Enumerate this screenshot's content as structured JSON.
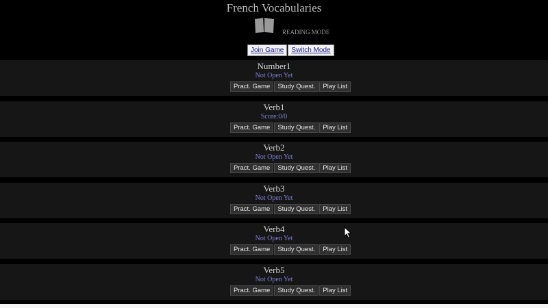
{
  "header": {
    "title": "French Vocabularies",
    "icon": "open-book-icon",
    "mode": "READING MODE",
    "buttons": {
      "join": "Join Game",
      "switch": "Switch Mode"
    }
  },
  "section_buttons": {
    "game": "Pract. Game",
    "study": "Study Quest.",
    "play": "Play List"
  },
  "sections": [
    {
      "name": "Number1",
      "status": "Not Open Yet"
    },
    {
      "name": "Verb1",
      "status": "Score:0/0"
    },
    {
      "name": "Verb2",
      "status": "Not Open Yet"
    },
    {
      "name": "Verb3",
      "status": "Not Open Yet"
    },
    {
      "name": "Verb4",
      "status": "Not Open Yet"
    },
    {
      "name": "Verb5",
      "status": "Not Open Yet"
    }
  ],
  "colors": {
    "background": "#000000",
    "section_bg": "#161616",
    "status": "#8080d8"
  }
}
